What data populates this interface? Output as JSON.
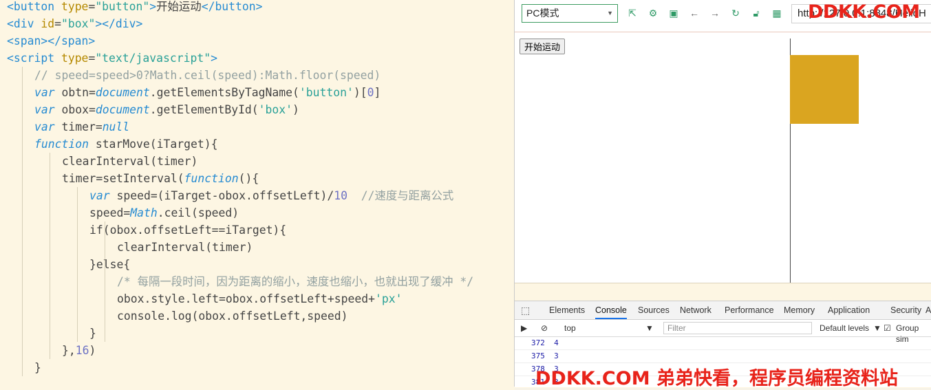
{
  "editor": {
    "lines": [
      {
        "indent": 0,
        "tokens": [
          [
            "tag",
            "<button "
          ],
          [
            "attr",
            "type"
          ],
          [
            "pl",
            "="
          ],
          [
            "str",
            "\"button\""
          ],
          [
            "tag",
            ">"
          ],
          [
            "pl",
            "开始运动"
          ],
          [
            "tag",
            "</button>"
          ]
        ]
      },
      {
        "indent": 0,
        "tokens": [
          [
            "tag",
            "<div "
          ],
          [
            "attr",
            "id"
          ],
          [
            "pl",
            "="
          ],
          [
            "str",
            "\"box\""
          ],
          [
            "tag",
            "></div>"
          ]
        ]
      },
      {
        "indent": 0,
        "tokens": [
          [
            "tag",
            "<span></span>"
          ]
        ]
      },
      {
        "indent": 0,
        "tokens": [
          [
            "tag",
            "<script "
          ],
          [
            "attr",
            "type"
          ],
          [
            "pl",
            "="
          ],
          [
            "str",
            "\"text/javascript\""
          ],
          [
            "tag",
            ">"
          ]
        ]
      },
      {
        "indent": 1,
        "tokens": [
          [
            "cm",
            "// speed=speed>0?Math.ceil(speed):Math.floor(speed)"
          ]
        ]
      },
      {
        "indent": 1,
        "tokens": [
          [
            "kw",
            "var"
          ],
          [
            "pl",
            " obtn="
          ],
          [
            "fn",
            "document"
          ],
          [
            "pl",
            ".getElementsByTagName("
          ],
          [
            "str",
            "'button'"
          ],
          [
            "pl",
            ")["
          ],
          [
            "num",
            "0"
          ],
          [
            "pl",
            "]"
          ]
        ]
      },
      {
        "indent": 1,
        "tokens": [
          [
            "kw",
            "var"
          ],
          [
            "pl",
            " obox="
          ],
          [
            "fn",
            "document"
          ],
          [
            "pl",
            ".getElementById("
          ],
          [
            "str",
            "'box'"
          ],
          [
            "pl",
            ")"
          ]
        ]
      },
      {
        "indent": 1,
        "tokens": [
          [
            "kw",
            "var"
          ],
          [
            "pl",
            " timer="
          ],
          [
            "kw",
            "null"
          ]
        ]
      },
      {
        "indent": 1,
        "tokens": [
          [
            "kw",
            "function"
          ],
          [
            "pl",
            " starMove(iTarget){"
          ]
        ]
      },
      {
        "indent": 2,
        "tokens": [
          [
            "pl",
            "clearInterval(timer)"
          ]
        ]
      },
      {
        "indent": 2,
        "tokens": [
          [
            "pl",
            "timer=setInterval("
          ],
          [
            "kw",
            "function"
          ],
          [
            "pl",
            "(){"
          ]
        ]
      },
      {
        "indent": 3,
        "tokens": [
          [
            "kw",
            "var"
          ],
          [
            "pl",
            " speed=(iTarget-obox.offsetLeft)/"
          ],
          [
            "num",
            "10"
          ],
          [
            "pl",
            "  "
          ],
          [
            "cm",
            "//速度与距离公式"
          ]
        ]
      },
      {
        "indent": 3,
        "tokens": [
          [
            "pl",
            "speed="
          ],
          [
            "fn",
            "Math"
          ],
          [
            "pl",
            ".ceil(speed)"
          ]
        ]
      },
      {
        "indent": 3,
        "tokens": [
          [
            "pl",
            "if(obox.offsetLeft==iTarget){"
          ]
        ]
      },
      {
        "indent": 4,
        "tokens": [
          [
            "pl",
            "clearInterval(timer)"
          ]
        ]
      },
      {
        "indent": 3,
        "tokens": [
          [
            "pl",
            "}else{"
          ]
        ]
      },
      {
        "indent": 4,
        "tokens": [
          [
            "cm",
            "/* 每隔一段时间，因为距离的缩小，速度也缩小，也就出现了缓冲 */"
          ]
        ]
      },
      {
        "indent": 4,
        "tokens": [
          [
            "pl",
            "obox.style.left=obox.offsetLeft+speed+"
          ],
          [
            "str",
            "'px'"
          ]
        ]
      },
      {
        "indent": 4,
        "tokens": [
          [
            "pl",
            "console.log(obox.offsetLeft,speed)"
          ]
        ]
      },
      {
        "indent": 3,
        "tokens": [
          [
            "pl",
            "}"
          ]
        ]
      },
      {
        "indent": 2,
        "tokens": [
          [
            "pl",
            "},"
          ],
          [
            "num",
            "16"
          ],
          [
            "pl",
            ")"
          ]
        ]
      },
      {
        "indent": 1,
        "tokens": [
          [
            "pl",
            "}"
          ]
        ]
      }
    ]
  },
  "browser": {
    "mode_select": "PC模式",
    "address": "http://127.0.0.1:8848/HelloH",
    "page": {
      "start_button": "开始运动",
      "box_color": "#daa520"
    }
  },
  "devtools": {
    "tabs": [
      "Elements",
      "Console",
      "Sources",
      "Network",
      "Performance",
      "Memory",
      "Application",
      "Security",
      "A"
    ],
    "active_tab": "Console",
    "context": "top",
    "filter_placeholder": "Filter",
    "levels": "Default levels",
    "group_similar": "Group sim",
    "logs": [
      "372  4",
      "375  3",
      "378  3",
      "381  3"
    ]
  },
  "watermarks": {
    "top": "DDKK.COM",
    "bottom": "DDKK.COM 弟弟快看，程序员编程资料站"
  }
}
